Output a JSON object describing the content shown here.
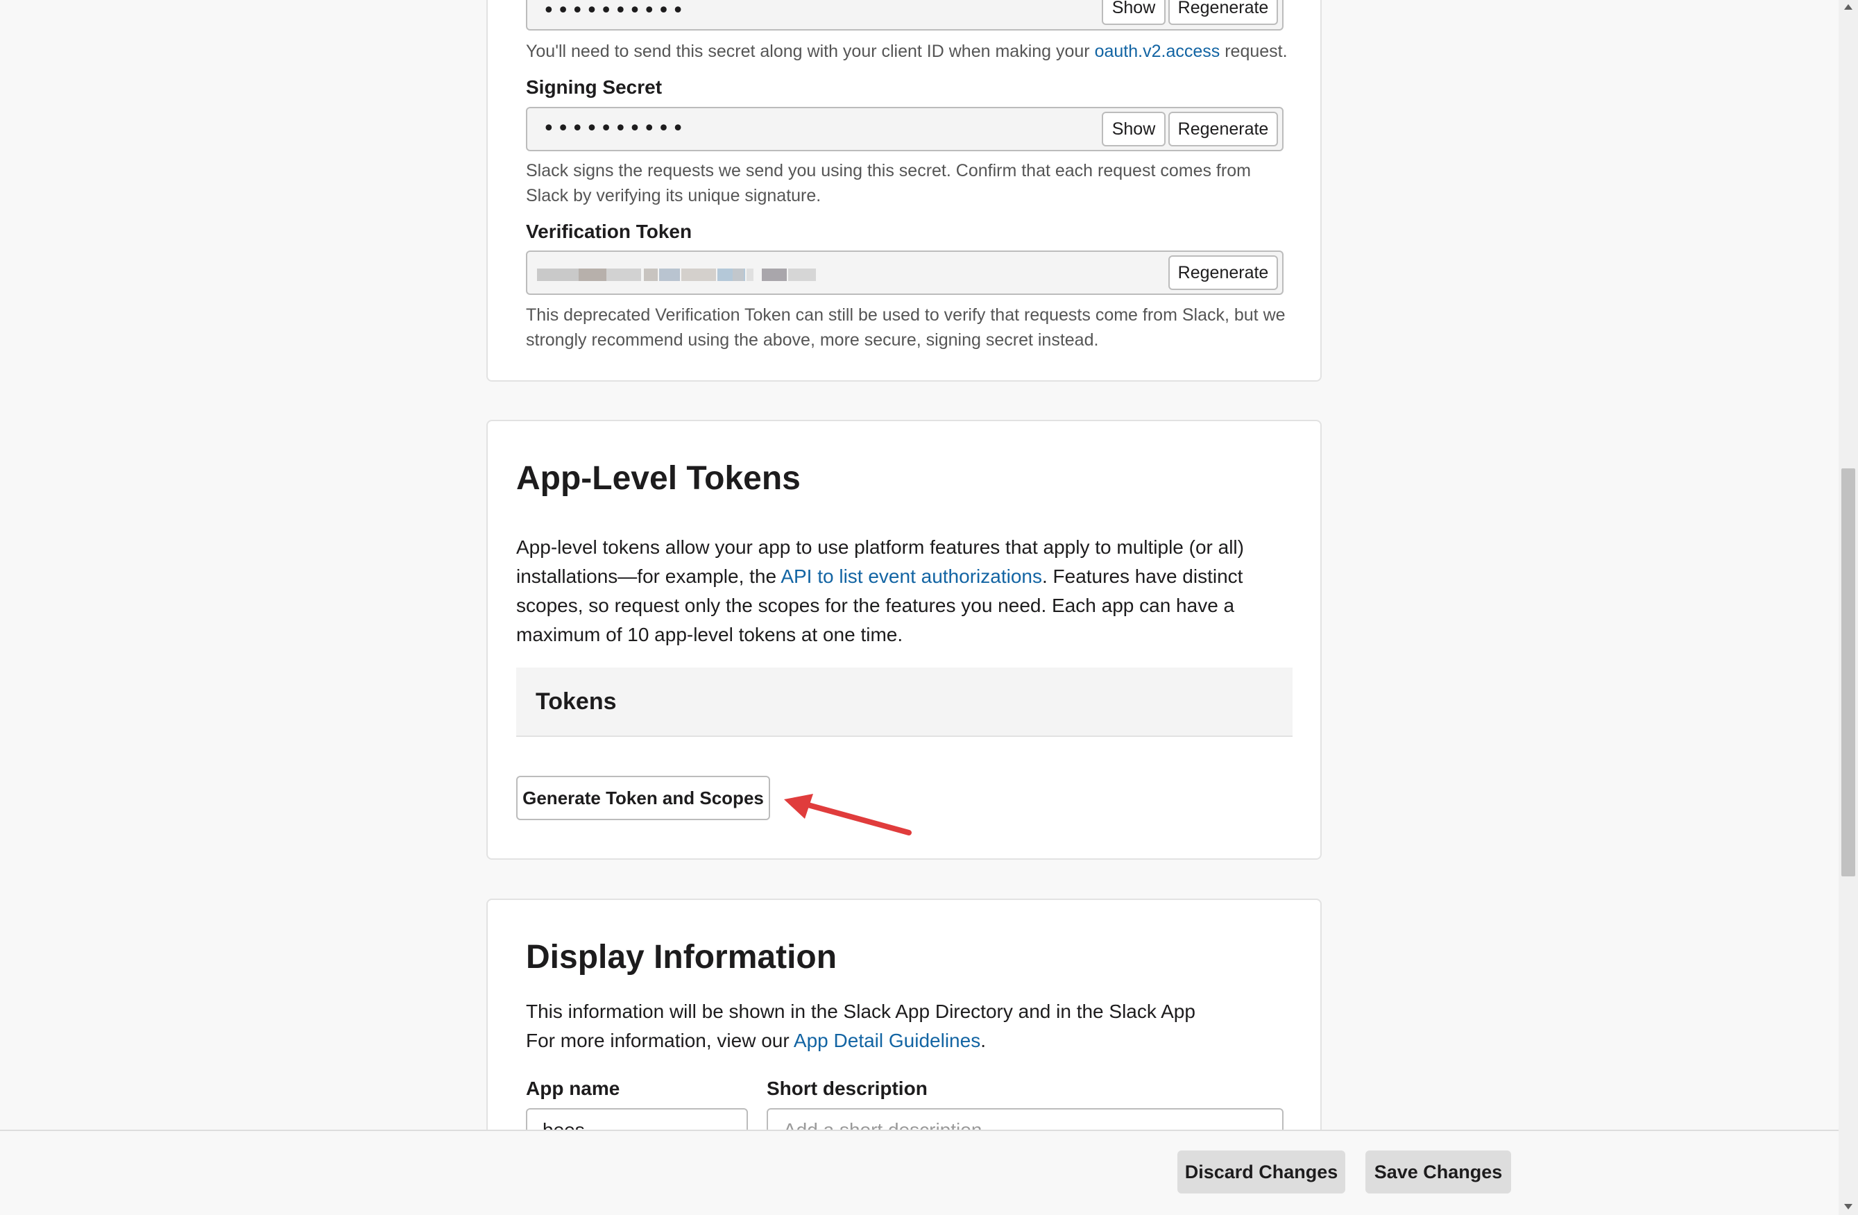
{
  "credentials": {
    "client_secret": {
      "masked_value": "••••••••••",
      "show_label": "Show",
      "regenerate_label": "Regenerate",
      "help_before": "You'll need to send this secret along with your client ID when making your ",
      "help_link": "oauth.v2.access",
      "help_after": " request."
    },
    "signing_secret": {
      "label": "Signing Secret",
      "masked_value": "••••••••••",
      "show_label": "Show",
      "regenerate_label": "Regenerate",
      "help_line1": "Slack signs the requests we send you using this secret. Confirm that each request comes from",
      "help_line2": "Slack by verifying its unique signature."
    },
    "verification_token": {
      "label": "Verification Token",
      "regenerate_label": "Regenerate",
      "help_line1": "This deprecated Verification Token can still be used to verify that requests come from Slack, but we",
      "help_line2": "strongly recommend using the above, more secure, signing secret instead."
    }
  },
  "app_level_tokens": {
    "title": "App-Level Tokens",
    "desc_line1": "App-level tokens allow your app to use platform features that apply to multiple (or all)",
    "desc_line2_before": "installations—for example, the ",
    "desc_line2_link": "API to list event authorizations",
    "desc_line2_after": ". Features have distinct",
    "desc_line3": "scopes, so request only the scopes for the features you need. Each app can have a",
    "desc_line4": "maximum of 10 app-level tokens at one time.",
    "tokens_header": "Tokens",
    "generate_button": "Generate Token and Scopes"
  },
  "display_information": {
    "title": "Display Information",
    "line1": "This information will be shown in the Slack App Directory and in the Slack App",
    "line2_before": "For more information, view our ",
    "line2_link": "App Detail Guidelines",
    "line2_after": ".",
    "app_name_label": "App name",
    "app_name_value": "bees",
    "short_desc_label": "Short description",
    "short_desc_placeholder": "Add a short description"
  },
  "footer": {
    "discard_label": "Discard Changes",
    "save_label": "Save Changes"
  },
  "colors": {
    "link": "#1264a3",
    "annotation_arrow": "#e03c3c"
  }
}
